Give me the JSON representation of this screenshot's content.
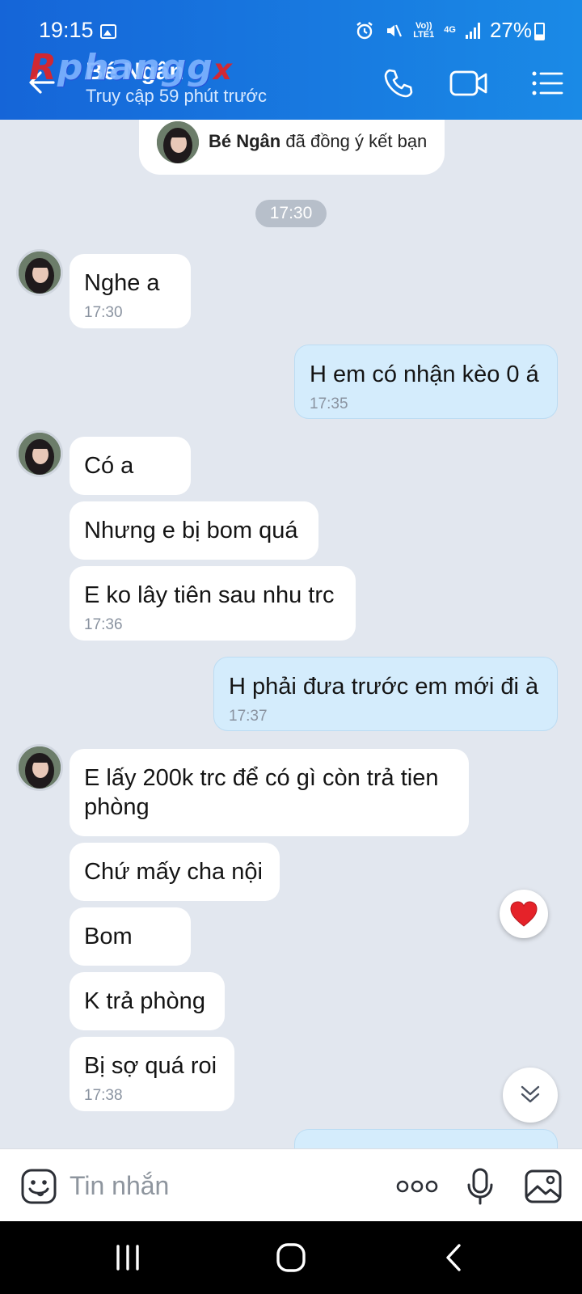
{
  "status_bar": {
    "time": "19:15",
    "battery": "27%",
    "network": "4G",
    "volte": "Vo)) LTE1"
  },
  "header": {
    "contact_name": "Bé Ngân",
    "last_seen": "Truy cập 59 phút trước",
    "logo_text": [
      "Rphang",
      "g",
      "x"
    ]
  },
  "friend_notice": {
    "name": "Bé Ngân",
    "text": "đã đồng ý kết bạn"
  },
  "time_divider": "17:30",
  "messages": [
    {
      "dir": "in",
      "text": "Nghe a",
      "time": "17:30"
    },
    {
      "dir": "out",
      "text": "H em có nhận kèo 0 á",
      "time": "17:35"
    },
    {
      "dir": "in",
      "text": "Có a"
    },
    {
      "dir": "in",
      "text": "Nhưng e bị bom quá"
    },
    {
      "dir": "in",
      "text": "E ko lây tiên sau nhu trc",
      "time": "17:36"
    },
    {
      "dir": "out",
      "text": "H phải đưa trước em mới đi à",
      "time": "17:37"
    },
    {
      "dir": "in",
      "text": "E lấy 200k trc để có gì còn trả tien phòng"
    },
    {
      "dir": "in",
      "text": "Chứ mấy cha nội"
    },
    {
      "dir": "in",
      "text": "Bom"
    },
    {
      "dir": "in",
      "text": "K trả phòng"
    },
    {
      "dir": "in",
      "text": "Bị sợ quá roi",
      "time": "17:38"
    }
  ],
  "input": {
    "placeholder": "Tin nhắn"
  },
  "colors": {
    "header": "#1a7fe4",
    "chat_bg": "#e2e7ef",
    "out_bubble": "#d4ecfc",
    "in_bubble": "#ffffff",
    "heart": "#e52229"
  },
  "icons": [
    "back-arrow-icon",
    "phone-icon",
    "video-call-icon",
    "menu-list-icon",
    "heart-icon",
    "chevron-double-down-icon",
    "sticker-icon",
    "more-icon",
    "microphone-icon",
    "image-icon"
  ]
}
